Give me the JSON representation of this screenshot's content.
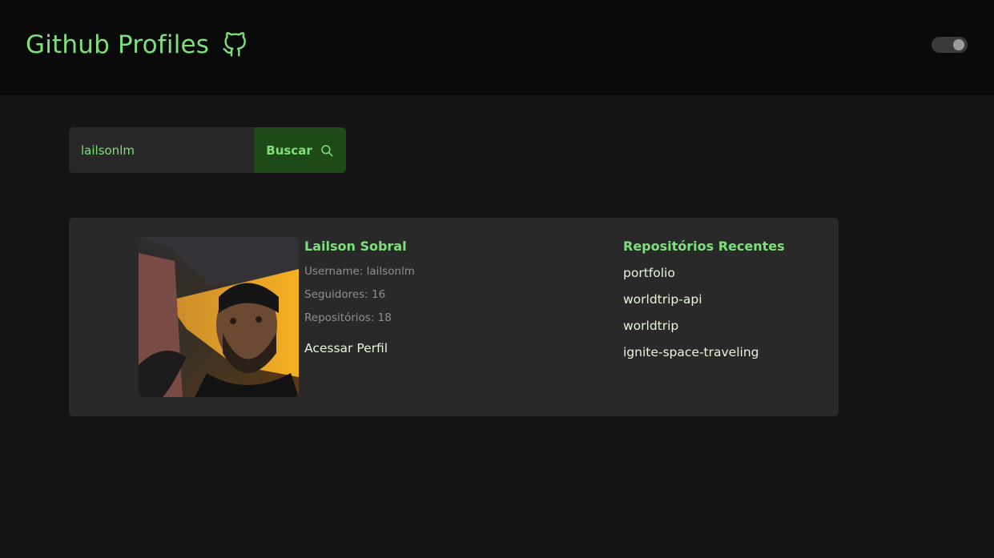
{
  "header": {
    "title": "Github Profiles",
    "icon": "github-icon",
    "theme_toggle": {
      "state": "on"
    }
  },
  "search": {
    "value": "lailsonlm",
    "button_label": "Buscar",
    "button_icon": "search-icon"
  },
  "profile": {
    "name": "Lailson Sobral",
    "username": "Username: lailsonlm",
    "followers": "Seguidores: 16",
    "repositories": "Repositórios: 18",
    "link_label": "Acessar Perfil"
  },
  "repos": {
    "title": "Repositórios Recentes",
    "items": [
      "portfolio",
      "worldtrip-api",
      "worldtrip",
      "ignite-space-traveling"
    ]
  },
  "colors": {
    "accent": "#7ee07a",
    "button_bg": "#1d4a17",
    "page_bg": "#141414",
    "header_bg": "#0a0a0a",
    "card_bg": "#292929"
  }
}
